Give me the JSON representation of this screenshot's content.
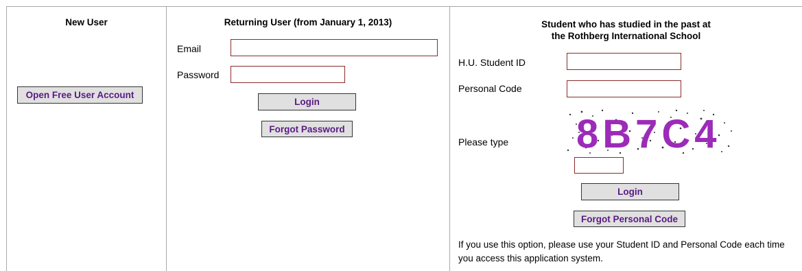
{
  "new_user": {
    "heading": "New User",
    "open_account_label": "Open Free User Account"
  },
  "returning_user": {
    "heading": "Returning User (from January 1, 2013)",
    "email_label": "Email",
    "email_value": "",
    "password_label": "Password",
    "password_value": "",
    "login_label": "Login",
    "forgot_password_label": "Forgot Password"
  },
  "past_student": {
    "heading_line1": "Student who has studied in the past at",
    "heading_line2": "the Rothberg International School",
    "student_id_label": "H.U. Student ID",
    "student_id_value": "",
    "personal_code_label": "Personal Code",
    "personal_code_value": "",
    "please_type_label": "Please type",
    "captcha_text": "8B7C4",
    "captcha_input_value": "",
    "login_label": "Login",
    "forgot_code_label": "Forgot Personal Code",
    "note": "If you use this option, please use your Student ID and Personal Code each time you access this application system."
  },
  "colors": {
    "button_text": "#5a1a82",
    "input_border": "#8b2a2a",
    "captcha_text": "#9b2bb8"
  }
}
